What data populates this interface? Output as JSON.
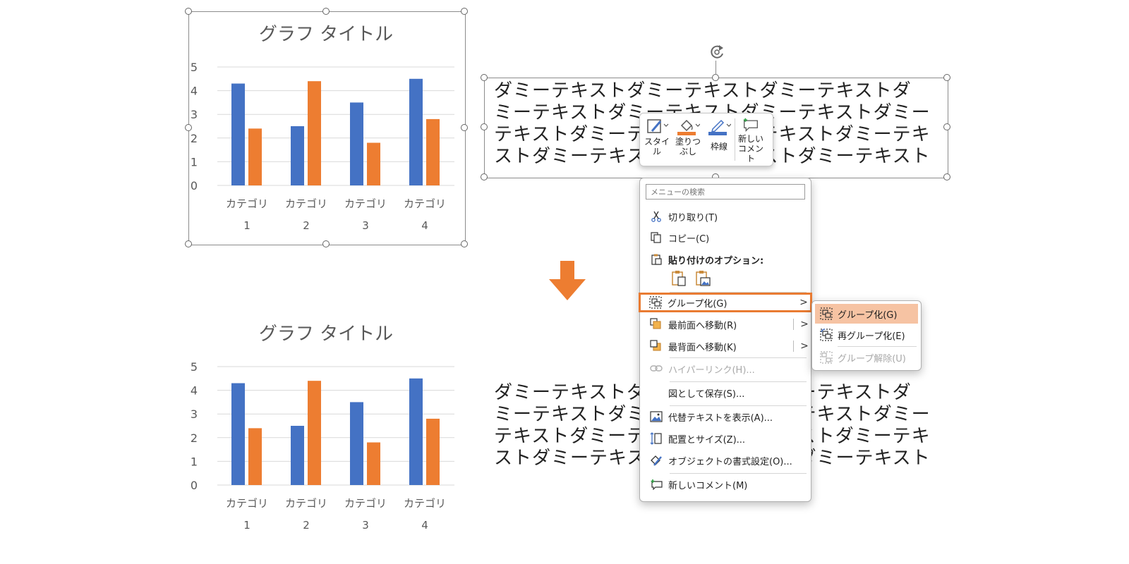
{
  "chart_data": [
    {
      "type": "bar",
      "title": "グラフ タイトル",
      "categories": [
        [
          "カテゴリ",
          "1"
        ],
        [
          "カテゴリ",
          "2"
        ],
        [
          "カテゴリ",
          "3"
        ],
        [
          "カテゴリ",
          "4"
        ]
      ],
      "series": [
        {
          "values": [
            4.3,
            2.5,
            3.5,
            4.5
          ],
          "color": "#4472c4"
        },
        {
          "values": [
            2.4,
            4.4,
            1.8,
            2.8
          ],
          "color": "#ed7d31"
        }
      ],
      "ylim": [
        0,
        5
      ],
      "yticks": [
        "0",
        "1",
        "2",
        "3",
        "4",
        "5"
      ],
      "grid": true,
      "selected": true
    },
    {
      "type": "bar",
      "title": "グラフ タイトル",
      "categories": [
        [
          "カテゴリ",
          "1"
        ],
        [
          "カテゴリ",
          "2"
        ],
        [
          "カテゴリ",
          "3"
        ],
        [
          "カテゴリ",
          "4"
        ]
      ],
      "series": [
        {
          "values": [
            4.3,
            2.5,
            3.5,
            4.5
          ],
          "color": "#4472c4"
        },
        {
          "values": [
            2.4,
            4.4,
            1.8,
            2.8
          ],
          "color": "#ed7d31"
        }
      ],
      "ylim": [
        0,
        5
      ],
      "yticks": [
        "0",
        "1",
        "2",
        "3",
        "4",
        "5"
      ],
      "grid": true,
      "selected": false
    }
  ],
  "textbox_top": {
    "lines": [
      "ダミーテキストダミーテキストダミーテキストダ",
      "ミーテキストダミーテキストダミーテキストダミー",
      "テキストダミーテキストダミーテキストダミーテキ",
      "ストダミーテキストダミーテキストダミーテキスト"
    ]
  },
  "textbox_bottom": {
    "lines": [
      "ダミーテキストダミーテキストダミーテキストダ",
      "ミーテキストダミーテキストダミーテキストダミー",
      "テキストダミーテキストダミーテキストダミーテキ",
      "ストダミーテキストダミーテキストダミーテキスト"
    ]
  },
  "colors": {
    "accent_orange": "#ed7d31",
    "blue": "#4472c4",
    "highlight_border": "#e97b32",
    "submenu_active": "#f6c3a3"
  },
  "mini_toolbar": {
    "style": {
      "line1": "スタイ",
      "line2": "ル",
      "icon": "style-brush-icon"
    },
    "fill": {
      "line1": "塗りつ",
      "line2": "ぶし",
      "icon": "paint-bucket-icon"
    },
    "outline": {
      "label": "枠線",
      "icon": "pen-outline-icon"
    },
    "comment": {
      "line1": "新しい",
      "line2": "コメント",
      "icon": "new-comment-icon"
    }
  },
  "context_menu": {
    "search_placeholder": "メニューの検索",
    "cut": "切り取り(T)",
    "copy": "コピー(C)",
    "paste_options": "貼り付けのオプション:",
    "group": "グループ化(G)",
    "bring_front": "最前面へ移動(R)",
    "send_back": "最背面へ移動(K)",
    "hyperlink": "ハイパーリンク(H)...",
    "save_as_picture": "図として保存(S)...",
    "alt_text": "代替テキストを表示(A)...",
    "size_position": "配置とサイズ(Z)...",
    "format_object": "オブジェクトの書式設定(O)...",
    "new_comment": "新しいコメント(M)"
  },
  "submenu": {
    "group": "グループ化(G)",
    "regroup": "再グループ化(E)",
    "ungroup": "グループ解除(U)"
  }
}
